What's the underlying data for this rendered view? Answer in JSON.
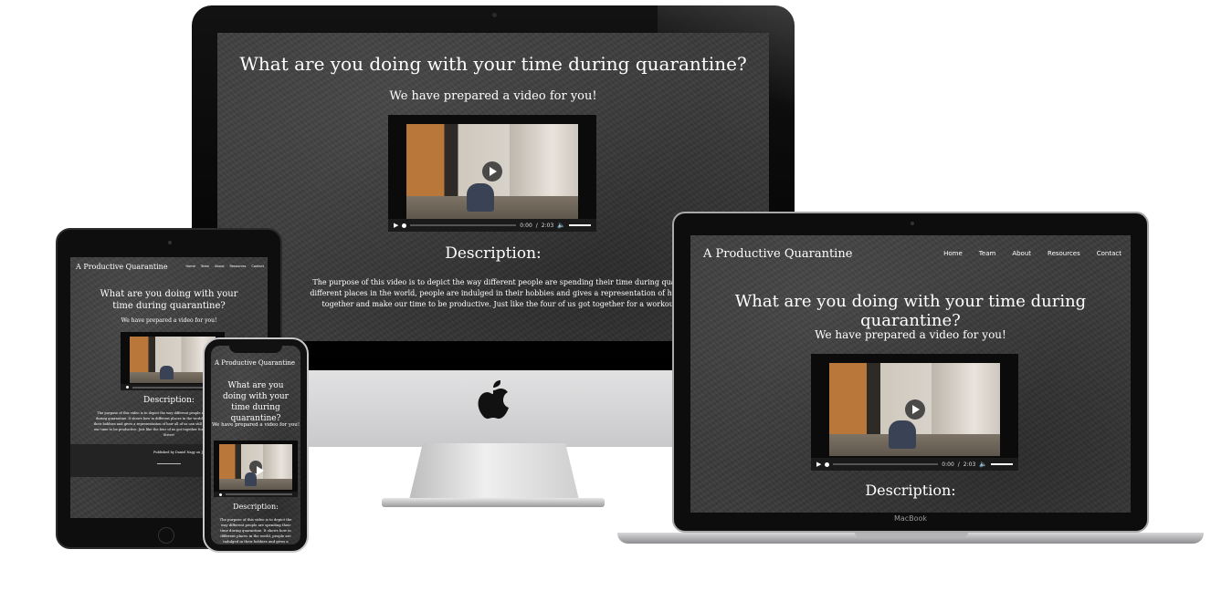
{
  "site": {
    "brand": "A Productive Quarantine",
    "nav": [
      "Home",
      "Team",
      "About",
      "Resources",
      "Contact"
    ],
    "headline": "What are you doing with your time during quarantine?",
    "subheadline": "We have prepared a video for you!",
    "description_heading": "Description:",
    "description_text": "The purpose of this video is to depict the way different people are spending their time during quarantine. It shows how in different places in the world, people are indulged in their hobbies and gives a representation of how all of us can still come together and make our time to be productive. Just like the four of us got together for a workout. Together We Strive!",
    "footer_text": "Published by Daniel Nagy on Jun 4, 2020.",
    "video": {
      "time_current": "0:00",
      "time_total": "2:03",
      "time_sep": "/",
      "progress": 0.0,
      "volume": 1.0
    }
  },
  "devices": {
    "laptop_label": "MacBook"
  },
  "colors": {
    "background": "#3b3b3b",
    "text": "#ffffff",
    "page": "#ffffff"
  },
  "icons": [
    "apple-logo-icon",
    "play-icon",
    "volume-icon",
    "camera-icon"
  ]
}
